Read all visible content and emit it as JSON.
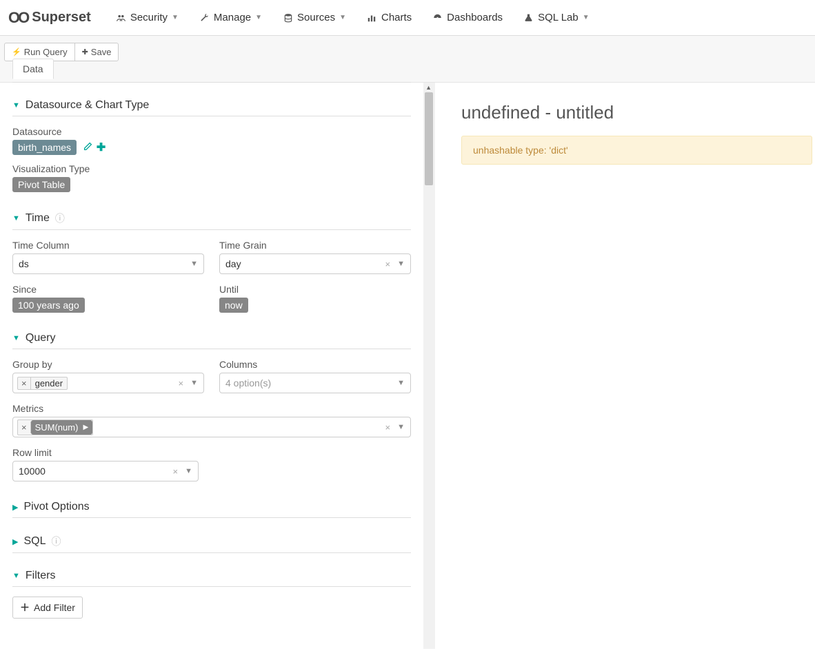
{
  "brand": {
    "name": "Superset"
  },
  "nav": {
    "security": "Security",
    "manage": "Manage",
    "sources": "Sources",
    "charts": "Charts",
    "dashboards": "Dashboards",
    "sqllab": "SQL Lab"
  },
  "toolbar": {
    "run_query": "Run Query",
    "save": "Save"
  },
  "tabs": {
    "data": "Data"
  },
  "sections": {
    "datasource_chart_type": "Datasource & Chart Type",
    "time": "Time",
    "query": "Query",
    "pivot_options": "Pivot Options",
    "sql": "SQL",
    "filters": "Filters"
  },
  "datasource": {
    "label": "Datasource",
    "value": "birth_names",
    "viz_label": "Visualization Type",
    "viz_value": "Pivot Table"
  },
  "time": {
    "column_label": "Time Column",
    "column_value": "ds",
    "grain_label": "Time Grain",
    "grain_value": "day",
    "since_label": "Since",
    "since_value": "100 years ago",
    "until_label": "Until",
    "until_value": "now"
  },
  "query": {
    "groupby_label": "Group by",
    "groupby_value": "gender",
    "columns_label": "Columns",
    "columns_placeholder": "4 option(s)",
    "metrics_label": "Metrics",
    "metrics_value": "SUM(num)",
    "rowlimit_label": "Row limit",
    "rowlimit_value": "10000"
  },
  "filters": {
    "add_filter": "Add Filter"
  },
  "chart": {
    "title": "undefined - untitled",
    "error": "unhashable type: 'dict'"
  }
}
